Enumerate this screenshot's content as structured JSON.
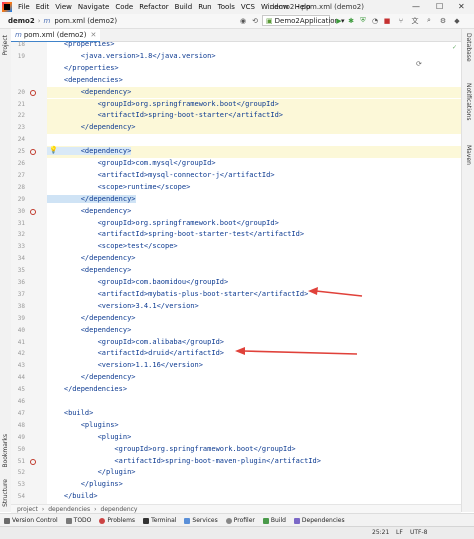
{
  "menubar": {
    "items": [
      "File",
      "Edit",
      "View",
      "Navigate",
      "Code",
      "Refactor",
      "Build",
      "Run",
      "Tools",
      "VCS",
      "Window",
      "Help"
    ],
    "window_title": "demo2 - pom.xml (demo2)",
    "controls": [
      "—",
      "☐",
      "✕"
    ]
  },
  "navbar": {
    "project": "demo2",
    "file": "pom.xml (demo2)",
    "run_config": "Demo2Application"
  },
  "left_strip": {
    "project": "Project",
    "bookmarks": "Bookmarks",
    "structure": "Structure"
  },
  "right_strip": {
    "database": "Database",
    "notifications": "Notifications",
    "maven": "Maven"
  },
  "tab": {
    "label": "pom.xml (demo2)"
  },
  "editor": {
    "lines": [
      {
        "num": "18",
        "text": "    <properties>"
      },
      {
        "num": "19",
        "text": "        <java.version>1.8</java.version>"
      },
      {
        "num": "",
        "text": "    </properties>"
      },
      {
        "num": "",
        "text": "    <dependencies>"
      },
      {
        "num": "20",
        "text": "        <dependency>"
      },
      {
        "num": "21",
        "text": "            <groupId>org.springframework.boot</groupId>"
      },
      {
        "num": "22",
        "text": "            <artifactId>spring-boot-starter</artifactId>"
      },
      {
        "num": "23",
        "text": "        </dependency>"
      },
      {
        "num": "24",
        "text": ""
      },
      {
        "num": "25",
        "text": "        <dependency>"
      },
      {
        "num": "26",
        "text": "            <groupId>com.mysql</groupId>"
      },
      {
        "num": "27",
        "text": "            <artifactId>mysql-connector-j</artifactId>"
      },
      {
        "num": "28",
        "text": "            <scope>runtime</scope>"
      },
      {
        "num": "29",
        "text": "        </dependency>"
      },
      {
        "num": "30",
        "text": "        <dependency>"
      },
      {
        "num": "31",
        "text": "            <groupId>org.springframework.boot</groupId>"
      },
      {
        "num": "32",
        "text": "            <artifactId>spring-boot-starter-test</artifactId>"
      },
      {
        "num": "33",
        "text": "            <scope>test</scope>"
      },
      {
        "num": "34",
        "text": "        </dependency>"
      },
      {
        "num": "35",
        "text": "        <dependency>"
      },
      {
        "num": "36",
        "text": "            <groupId>com.baomidou</groupId>"
      },
      {
        "num": "37",
        "text": "            <artifactId>mybatis-plus-boot-starter</artifactId>"
      },
      {
        "num": "38",
        "text": "            <version>3.4.1</version>"
      },
      {
        "num": "39",
        "text": "        </dependency>"
      },
      {
        "num": "40",
        "text": "        <dependency>"
      },
      {
        "num": "41",
        "text": "            <groupId>com.alibaba</groupId>"
      },
      {
        "num": "42",
        "text": "            <artifactId>druid</artifactId>"
      },
      {
        "num": "43",
        "text": "            <version>1.1.16</version>"
      },
      {
        "num": "44",
        "text": "        </dependency>"
      },
      {
        "num": "45",
        "text": "    </dependencies>"
      },
      {
        "num": "46",
        "text": ""
      },
      {
        "num": "47",
        "text": "    <build>"
      },
      {
        "num": "48",
        "text": "        <plugins>"
      },
      {
        "num": "49",
        "text": "            <plugin>"
      },
      {
        "num": "50",
        "text": "                <groupId>org.springframework.boot</groupId>"
      },
      {
        "num": "51",
        "text": "                <artifactId>spring-boot-maven-plugin</artifactId>"
      },
      {
        "num": "52",
        "text": "            </plugin>"
      },
      {
        "num": "53",
        "text": "        </plugins>"
      },
      {
        "num": "54",
        "text": "    </build>"
      }
    ]
  },
  "editor_breadcrumb": [
    "project",
    "dependencies",
    "dependency"
  ],
  "bottom_tools": [
    "Version Control",
    "TODO",
    "Problems",
    "Terminal",
    "Services",
    "Profiler",
    "Build",
    "Dependencies"
  ],
  "status": {
    "position": "25:21",
    "line_sep": "LF",
    "encoding": "UTF-8"
  },
  "colors": {
    "accent": "#4083c9",
    "tag": "#0c3a91",
    "highlight_yellow": "#fcf8d8",
    "arrow": "#e0413a"
  }
}
